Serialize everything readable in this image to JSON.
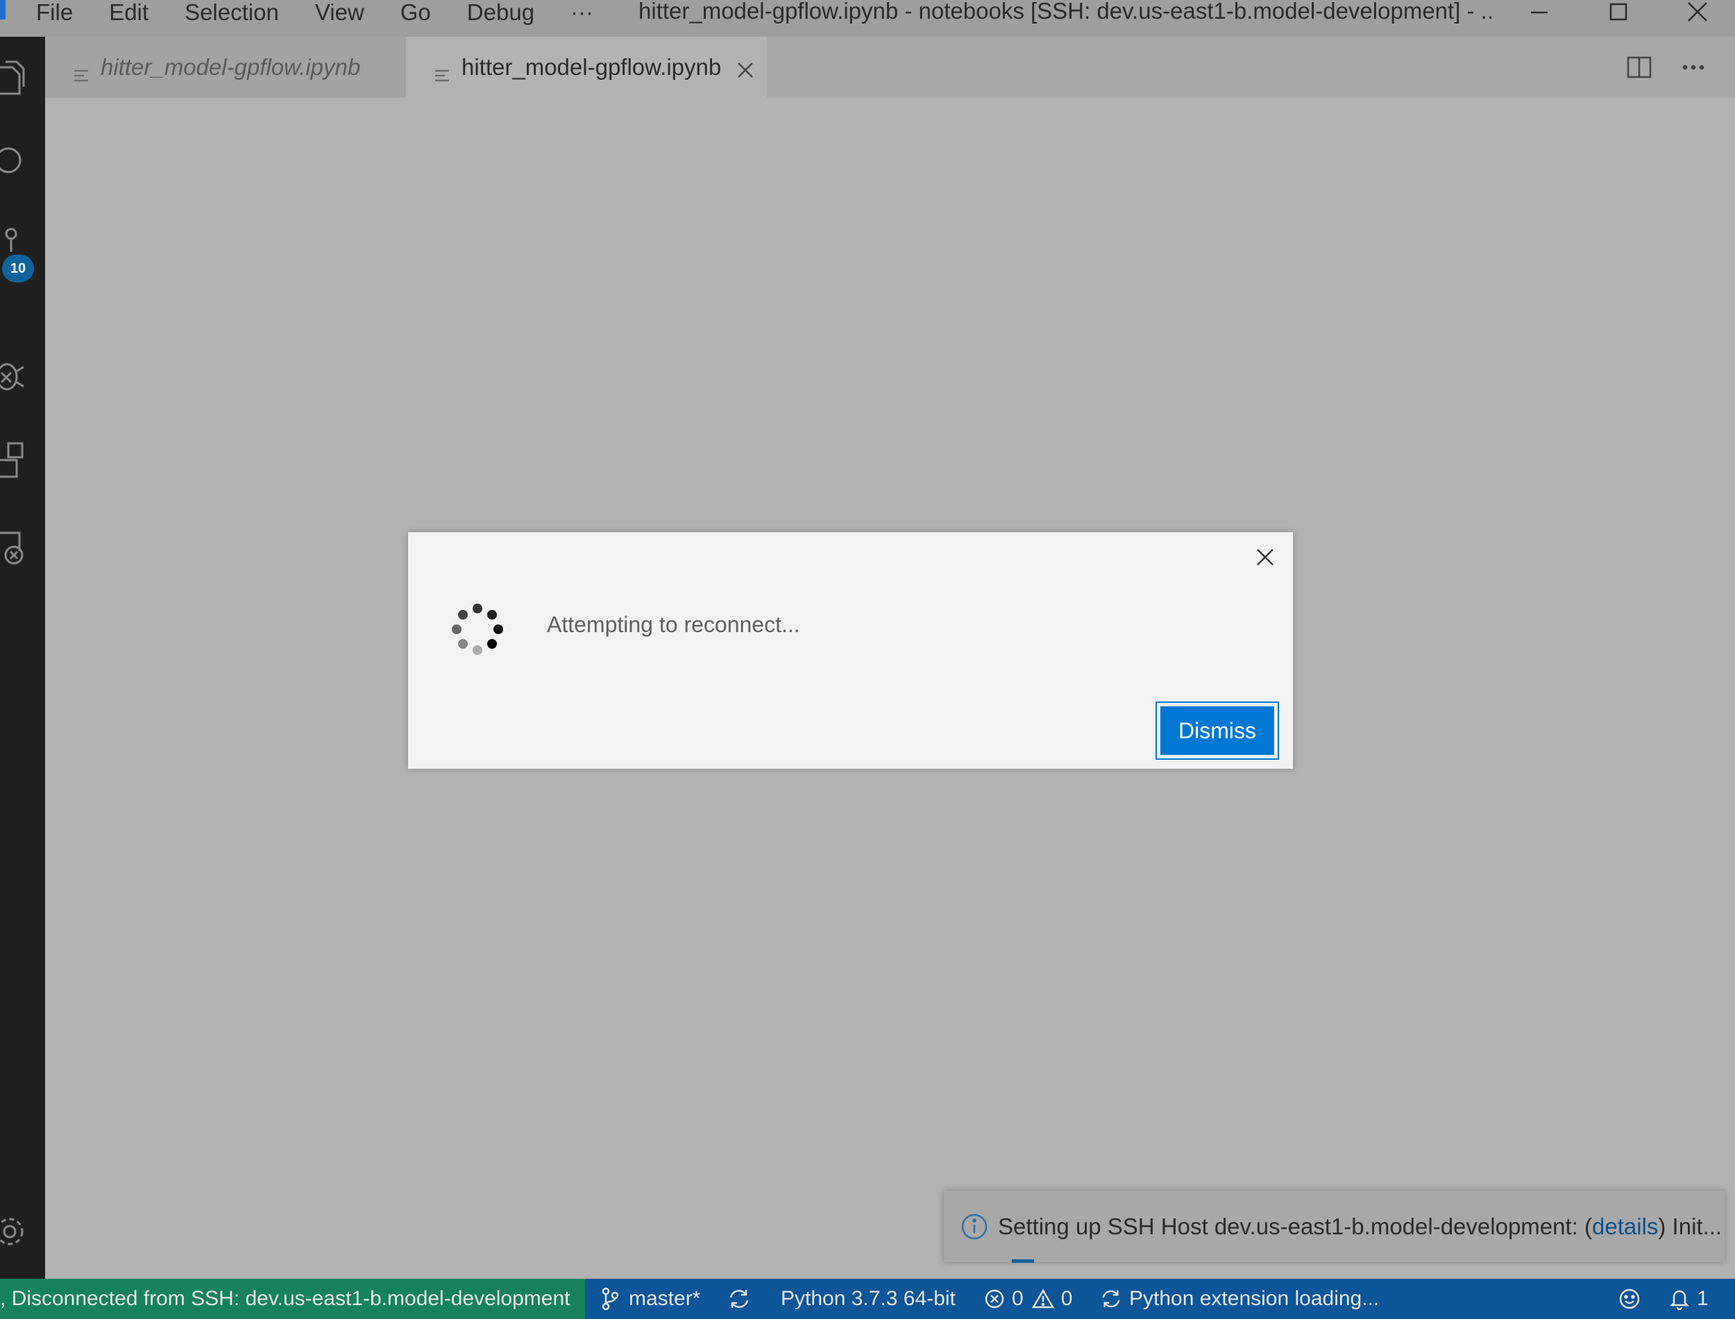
{
  "menu": {
    "items": [
      "File",
      "Edit",
      "Selection",
      "View",
      "Go",
      "Debug",
      "···"
    ]
  },
  "window": {
    "title": "hitter_model-gpflow.ipynb - notebooks [SSH: dev.us-east1-b.model-development] - ..."
  },
  "activity": {
    "badge_count": "10"
  },
  "tabs": [
    {
      "label": "hitter_model-gpflow.ipynb",
      "state": "inactive",
      "italic": true
    },
    {
      "label": "hitter_model-gpflow.ipynb",
      "state": "active",
      "italic": false
    }
  ],
  "dialog": {
    "message": "Attempting to reconnect...",
    "dismiss_label": "Dismiss"
  },
  "toast": {
    "text_before": "Setting up SSH Host dev.us-east1-b.model-development: (",
    "link": "details",
    "text_after": ") Init..."
  },
  "status": {
    "remote": ", Disconnected from SSH: dev.us-east1-b.model-development",
    "branch": "master*",
    "python": "Python 3.7.3 64-bit",
    "errors": "0",
    "warnings": "0",
    "extension": "Python extension loading...",
    "notifications": "1"
  },
  "colors": {
    "accent": "#0078d4",
    "status_bar": "#0c5598",
    "remote_indicator": "#16825d",
    "badge": "#0e639c"
  }
}
